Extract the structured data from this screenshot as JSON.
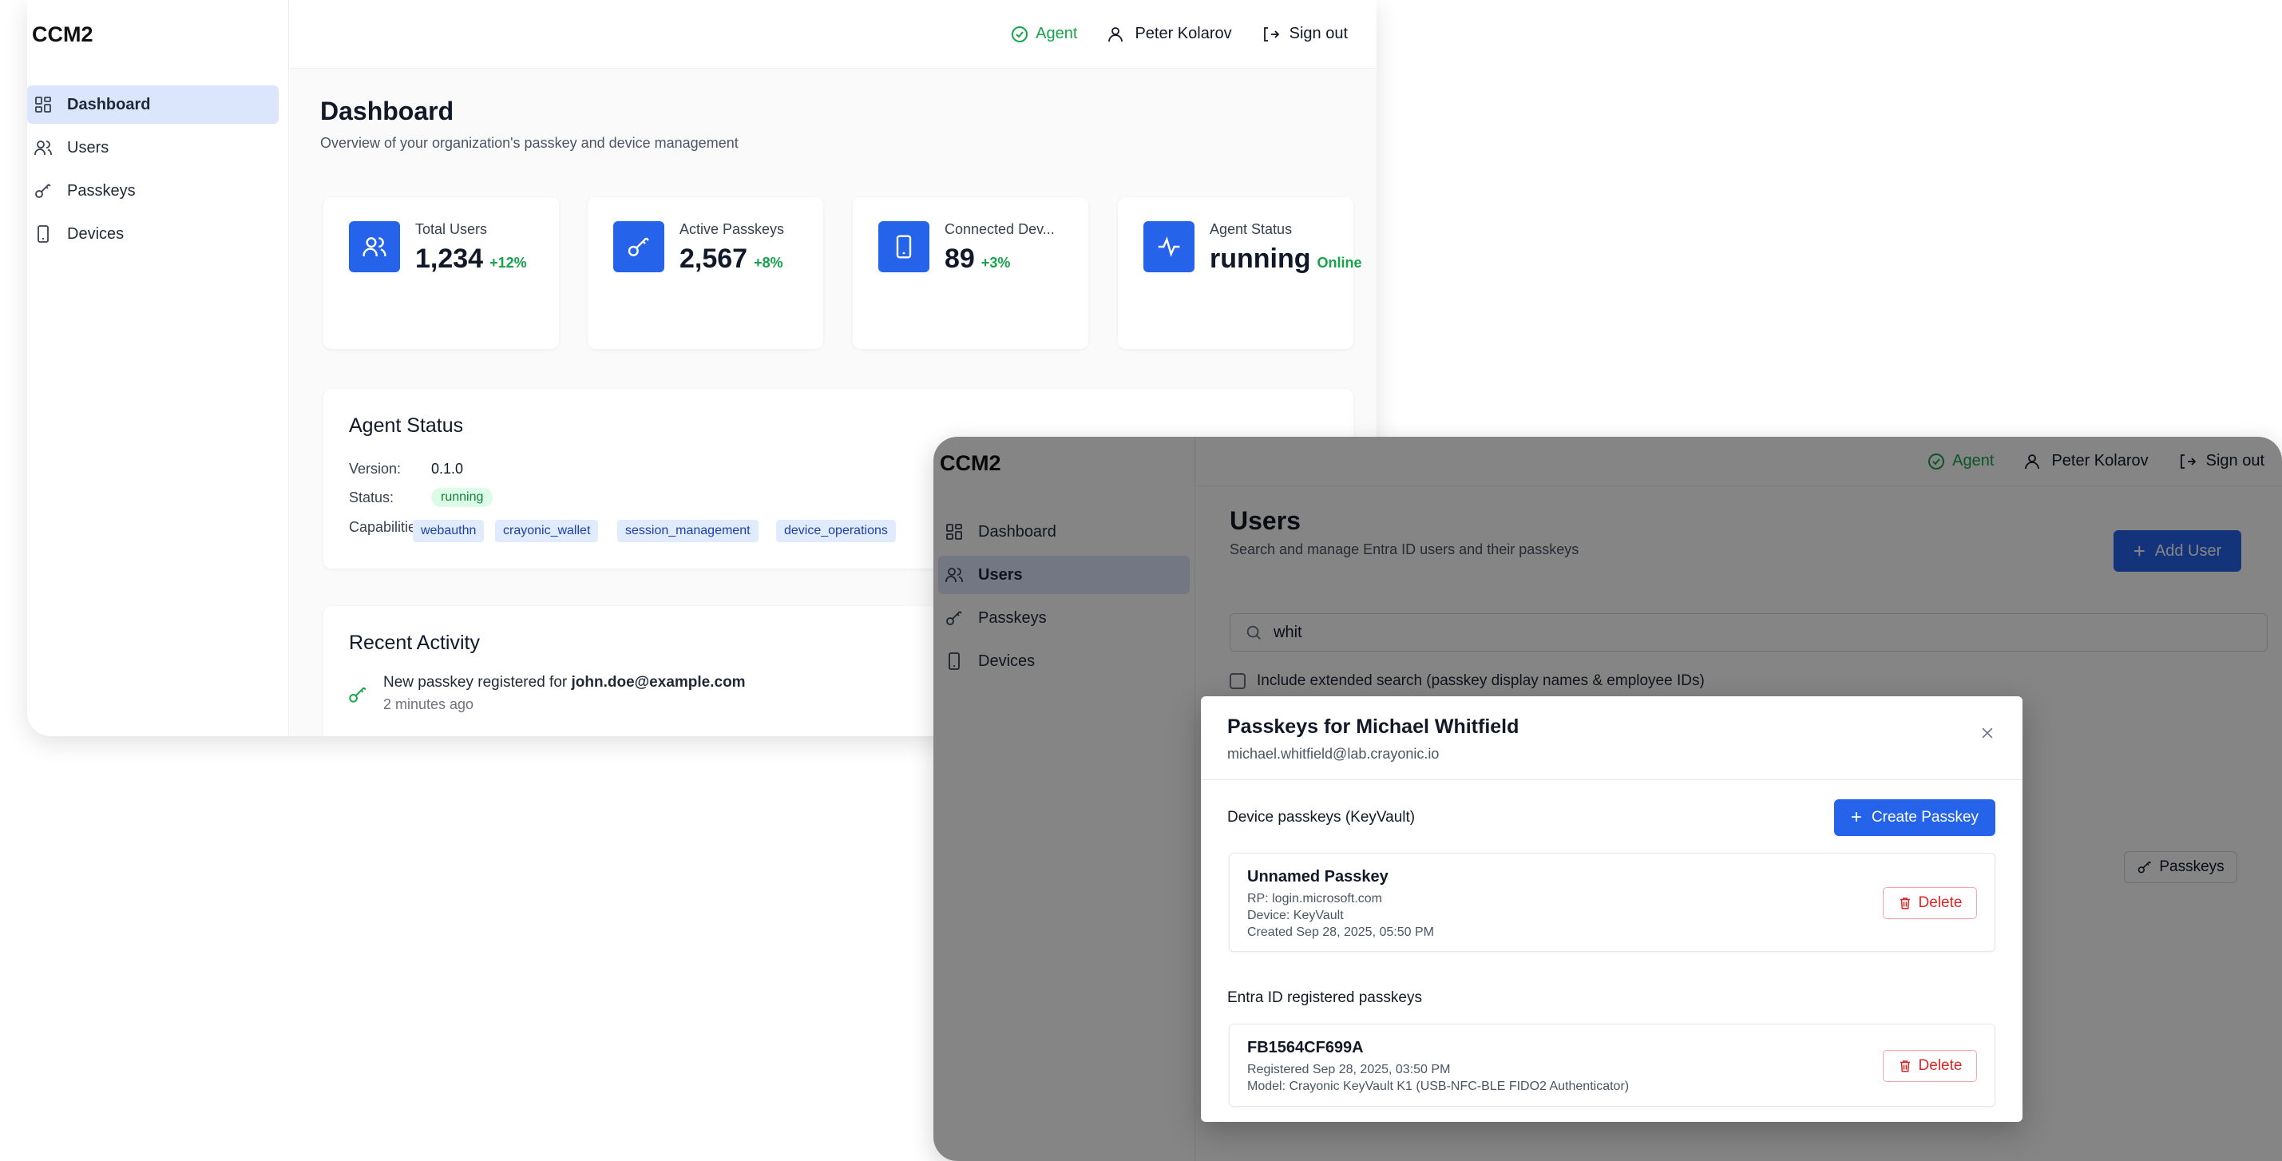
{
  "app": {
    "logo": "CCM2"
  },
  "topbar": {
    "agent": "Agent",
    "user": "Peter Kolarov",
    "signout": "Sign out"
  },
  "sidebar": {
    "items": [
      {
        "label": "Dashboard",
        "icon": "dashboard-icon"
      },
      {
        "label": "Users",
        "icon": "users-icon"
      },
      {
        "label": "Passkeys",
        "icon": "key-icon"
      },
      {
        "label": "Devices",
        "icon": "device-icon"
      }
    ]
  },
  "dashboard": {
    "title": "Dashboard",
    "subtitle": "Overview of your organization's passkey and device management",
    "stats": [
      {
        "label": "Total Users",
        "value": "1,234",
        "delta": "+12%",
        "icon": "users-icon"
      },
      {
        "label": "Active Passkeys",
        "value": "2,567",
        "delta": "+8%",
        "icon": "key-icon"
      },
      {
        "label": "Connected Dev...",
        "value": "89",
        "delta": "+3%",
        "icon": "device-icon"
      },
      {
        "label": "Agent Status",
        "value": "running",
        "delta": "Online",
        "icon": "activity-icon"
      }
    ],
    "agent_status": {
      "title": "Agent Status",
      "version_label": "Version:",
      "version": "0.1.0",
      "status_label": "Status:",
      "status": "running",
      "capabilities_label": "Capabilities:",
      "capabilities": [
        "webauthn",
        "crayonic_wallet",
        "session_management",
        "device_operations"
      ]
    },
    "recent_activity": {
      "title": "Recent Activity",
      "items": [
        {
          "text_prefix": "New passkey registered for ",
          "text_bold": "john.doe@example.com",
          "time": "2 minutes ago"
        }
      ]
    }
  },
  "users": {
    "title": "Users",
    "subtitle": "Search and manage Entra ID users and their passkeys",
    "add_button": "Add User",
    "search_value": "whit",
    "extended_search_label": "Include extended search (passkey display names & employee IDs)",
    "row_passkeys_button": "Passkeys"
  },
  "modal": {
    "title": "Passkeys for Michael Whitfield",
    "email": "michael.whitfield@lab.crayonic.io",
    "device_section": "Device passkeys (KeyVault)",
    "create_button": "Create Passkey",
    "device_passkeys": [
      {
        "name": "Unnamed Passkey",
        "rp": "RP: login.microsoft.com",
        "device": "Device: KeyVault",
        "created": "Created Sep 28, 2025, 05:50 PM",
        "delete": "Delete"
      }
    ],
    "entra_section": "Entra ID registered passkeys",
    "entra_passkeys": [
      {
        "name": "FB1564CF699A",
        "registered": "Registered Sep 28, 2025, 03:50 PM",
        "model": "Model: Crayonic KeyVault K1 (USB-NFC-BLE FIDO2 Authenticator)",
        "delete": "Delete"
      }
    ]
  },
  "colors": {
    "accent": "#2563eb",
    "success": "#16a34a",
    "danger": "#dc2626",
    "active_nav": "#dbe5fb"
  }
}
